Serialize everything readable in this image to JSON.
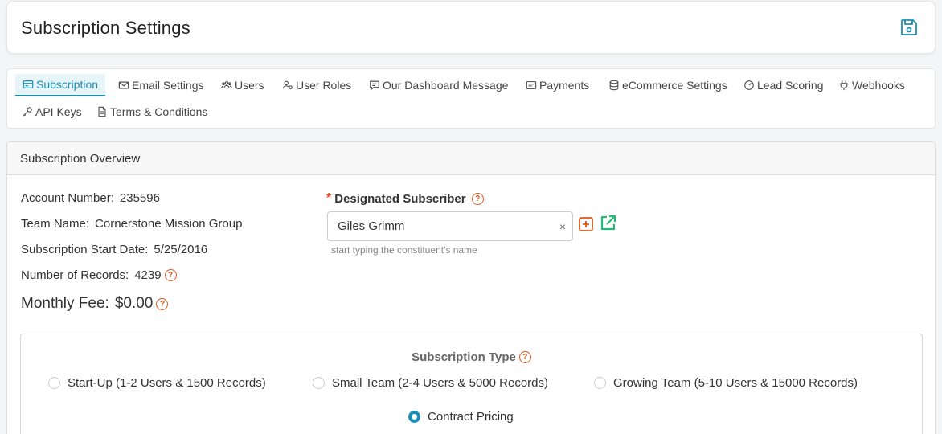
{
  "header": {
    "title": "Subscription Settings"
  },
  "tabs": [
    {
      "label": "Subscription",
      "icon": "card-icon"
    },
    {
      "label": "Email Settings",
      "icon": "envelope-icon"
    },
    {
      "label": "Users",
      "icon": "users-icon"
    },
    {
      "label": "User Roles",
      "icon": "user-roles-icon"
    },
    {
      "label": "Our Dashboard Message",
      "icon": "message-icon"
    },
    {
      "label": "Payments",
      "icon": "payments-icon"
    },
    {
      "label": "eCommerce Settings",
      "icon": "database-icon"
    },
    {
      "label": "Lead Scoring",
      "icon": "gauge-icon"
    },
    {
      "label": "Webhooks",
      "icon": "plug-icon"
    },
    {
      "label": "API Keys",
      "icon": "key-icon"
    },
    {
      "label": "Terms & Conditions",
      "icon": "document-icon"
    }
  ],
  "overview": {
    "title": "Subscription Overview",
    "account_label": "Account Number:",
    "account_value": "235596",
    "team_label": "Team Name:",
    "team_value": "Cornerstone Mission Group",
    "start_label": "Subscription Start Date:",
    "start_value": "5/25/2016",
    "records_label": "Number of Records:",
    "records_value": "4239",
    "fee_label": "Monthly Fee:",
    "fee_value": "$0.00"
  },
  "subscriber": {
    "required_mark": "*",
    "label": "Designated Subscriber",
    "value": "Giles Grimm",
    "clear": "×",
    "help": "start typing the constituent's name"
  },
  "subscription_type": {
    "title": "Subscription Type",
    "options": [
      {
        "label": "Start-Up (1-2 Users & 1500 Records)",
        "checked": false
      },
      {
        "label": "Small Team (2-4 Users & 5000 Records)",
        "checked": false
      },
      {
        "label": "Growing Team (5-10 Users & 15000 Records)",
        "checked": false
      },
      {
        "label": "Contract Pricing",
        "checked": true
      }
    ]
  },
  "help_glyph": "?",
  "colors": {
    "accent": "#1b8fb3",
    "warning": "#e0561f",
    "success": "#2ab77a"
  }
}
